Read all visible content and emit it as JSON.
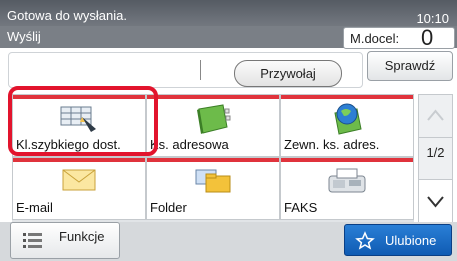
{
  "status": {
    "message": "Gotowa do wysłania.",
    "time": "10:10",
    "screen_title": "Wyślij"
  },
  "mdocel": {
    "label": "M.docel:",
    "count": "0"
  },
  "address": {
    "recall_label": "Przywołaj",
    "check_label": "Sprawdź"
  },
  "tiles": [
    {
      "label": "Kl.szybkiego dost.",
      "icon": "quick-dial-icon"
    },
    {
      "label": "Ks. adresowa",
      "icon": "address-book-icon"
    },
    {
      "label": "Zewn. ks. adres.",
      "icon": "external-address-book-icon"
    },
    {
      "label": "E-mail",
      "icon": "email-icon"
    },
    {
      "label": "Folder",
      "icon": "folder-icon"
    },
    {
      "label": "FAKS",
      "icon": "fax-icon"
    }
  ],
  "pager": {
    "indicator": "1/2"
  },
  "bottom": {
    "functions_label": "Funkcje",
    "favorites_label": "Ulubione"
  }
}
